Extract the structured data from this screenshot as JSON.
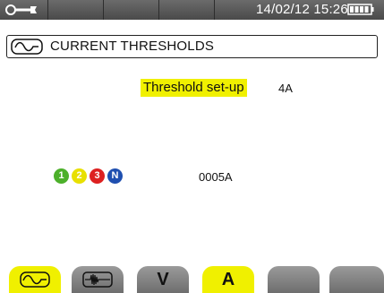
{
  "status_bar": {
    "datetime": "14/02/12 15:26",
    "icons": [
      "wrench-icon",
      "battery-icon"
    ]
  },
  "title": {
    "icon": "current-waveform-icon",
    "text": "CURRENT THRESHOLDS"
  },
  "threshold": {
    "label": "Threshold set-up",
    "value": "4A"
  },
  "phases": {
    "labels": [
      "1",
      "2",
      "3",
      "N"
    ],
    "colors": [
      "#4cb02a",
      "#e8e000",
      "#dd2020",
      "#1f4fb0"
    ],
    "value": "0005A"
  },
  "tabs": [
    {
      "icon": "current-waveform-icon",
      "label": "",
      "active": true
    },
    {
      "icon": "inrush-icon",
      "label": "",
      "active": false
    },
    {
      "icon": "",
      "label": "V",
      "active": false
    },
    {
      "icon": "",
      "label": "A",
      "active": true
    },
    {
      "icon": "",
      "label": "",
      "active": false
    },
    {
      "icon": "",
      "label": "",
      "active": false
    }
  ],
  "colors": {
    "highlight": "#f0f000",
    "status_bar": "#555555"
  }
}
